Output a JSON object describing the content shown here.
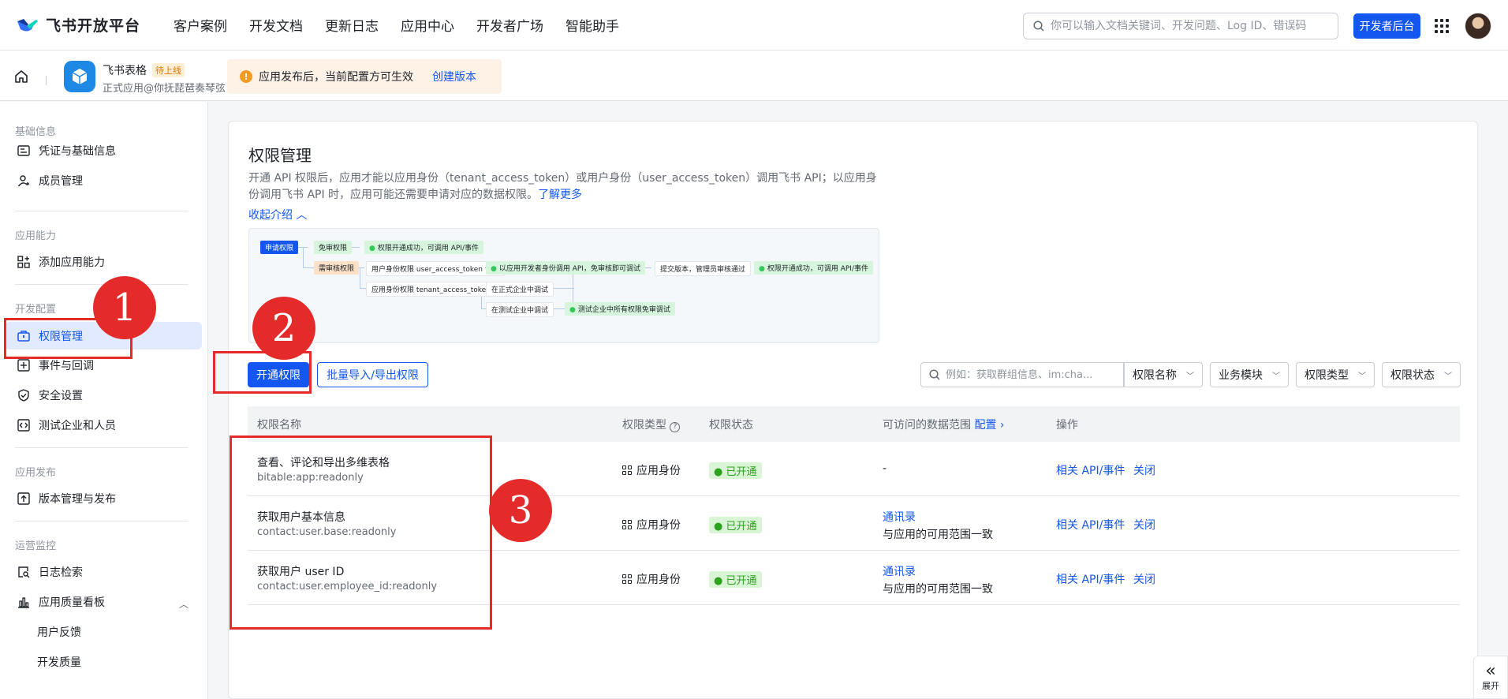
{
  "topnav": {
    "logo": "飞书开放平台",
    "items": [
      "客户案例",
      "开发文档",
      "更新日志",
      "应用中心",
      "开发者广场",
      "智能助手"
    ],
    "search_placeholder": "你可以输入文档关键词、开发问题、Log ID、错误码",
    "dev_button": "开发者后台"
  },
  "appbar": {
    "app_name": "飞书表格",
    "badge": "待上线",
    "app_sub": "正式应用@你抚琵琶奏琴弦",
    "notice": "应用发布后，当前配置方可生效",
    "notice_link": "创建版本"
  },
  "sidebar": {
    "groups": [
      {
        "title": "基础信息",
        "items": [
          "凭证与基础信息",
          "成员管理"
        ]
      },
      {
        "title": "应用能力",
        "items": [
          "添加应用能力"
        ]
      },
      {
        "title": "开发配置",
        "items": [
          "权限管理",
          "事件与回调",
          "安全设置",
          "测试企业和人员"
        ]
      },
      {
        "title": "应用发布",
        "items": [
          "版本管理与发布"
        ]
      },
      {
        "title": "运营监控",
        "items": [
          "日志检索",
          "应用质量看板",
          "用户反馈",
          "开发质量"
        ]
      }
    ]
  },
  "main": {
    "title": "权限管理",
    "intro": "开通 API 权限后，应用才能以应用身份（tenant_access_token）或用户身份（user_access_token）调用飞书 API；以应用身份调用飞书 API 时，应用可能还需要申请对应的数据权限。",
    "intro_link": "了解更多",
    "collapse": "收起介绍",
    "flow": {
      "apply": "申请权限",
      "free": "免审权限",
      "free_result": "权限开通成功，可调用 API/事件",
      "review": "需审核权限",
      "user_token": "用户身份权限 user_access_token 调用",
      "user_result": "以应用开发者身份调用 API，免审核即可调试",
      "submit": "提交版本，管理员审核通过",
      "final_result": "权限开通成功，可调用 API/事件",
      "tenant_token": "应用身份权限 tenant_access_token 调用",
      "prod_debug": "在正式企业中调试",
      "test_debug": "在测试企业中调试",
      "test_result": "测试企业中所有权限免审调试"
    },
    "btn_open": "开通权限",
    "btn_batch": "批量导入/导出权限",
    "filter_placeholder": "例如：获取群组信息、im:cha...",
    "filters": [
      "权限名称",
      "业务模块",
      "权限类型",
      "权限状态"
    ],
    "columns": [
      "权限名称",
      "权限类型",
      "权限状态",
      "可访问的数据范围",
      "配置",
      "操作"
    ],
    "rows": [
      {
        "name": "查看、评论和导出多维表格",
        "code": "bitable:app:readonly",
        "type": "应用身份",
        "status": "已开通",
        "scope": "-",
        "scope_link": "",
        "scope_sub": "",
        "act1": "相关 API/事件",
        "act2": "关闭"
      },
      {
        "name": "获取用户基本信息",
        "code": "contact:user.base:readonly",
        "type": "应用身份",
        "status": "已开通",
        "scope": "",
        "scope_link": "通讯录",
        "scope_sub": "与应用的可用范围一致",
        "act1": "相关 API/事件",
        "act2": "关闭"
      },
      {
        "name": "获取用户 user ID",
        "code": "contact:user.employee_id:readonly",
        "type": "应用身份",
        "status": "已开通",
        "scope": "",
        "scope_link": "通讯录",
        "scope_sub": "与应用的可用范围一致",
        "act1": "相关 API/事件",
        "act2": "关闭"
      }
    ]
  },
  "annotations": [
    "1",
    "2",
    "3"
  ],
  "expand_label": "展开",
  "colors": {
    "primary": "#1456f0",
    "annotation": "#e52a2a",
    "success": "#2ea121"
  }
}
